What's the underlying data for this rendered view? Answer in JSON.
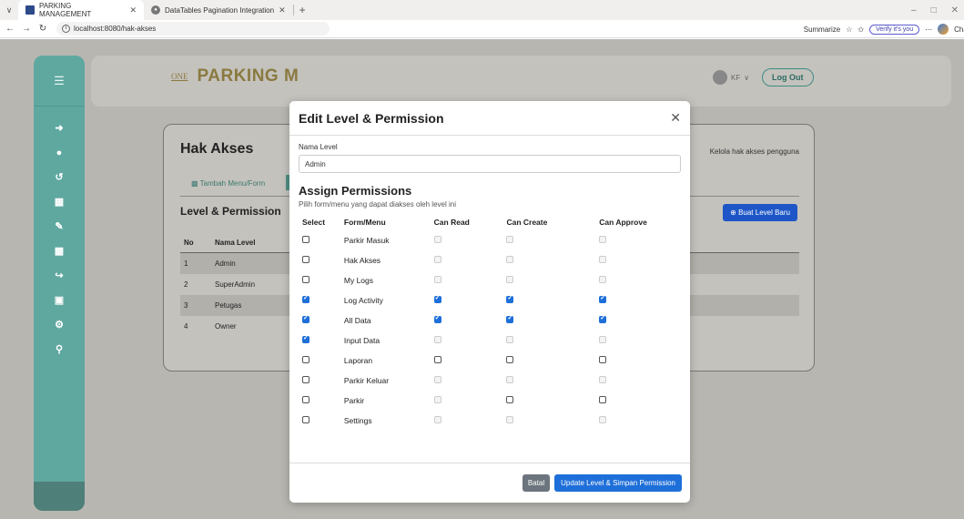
{
  "browser": {
    "tabs": [
      {
        "title": "PARKING MANAGEMENT",
        "active": true
      },
      {
        "title": "DataTables Pagination Integration",
        "active": false
      }
    ],
    "url": "localhost:8080/hak-akses",
    "right": {
      "summarize": "Summarize",
      "verify": "Verify it's you",
      "chat": "Chat"
    }
  },
  "app": {
    "brand_logo": "ONE",
    "brand_name": "PARKING M",
    "user_initials": "KF",
    "logout_label": "Log Out",
    "sidebar_icons": [
      "menu-icon",
      "login-icon",
      "users-icon",
      "history-icon",
      "table-icon",
      "pen-icon",
      "report-icon",
      "logout-arrow-icon",
      "card-icon",
      "gear-icon",
      "key-icon"
    ]
  },
  "card": {
    "title": "Hak Akses",
    "subtitle": "Kelola hak akses pengguna",
    "tab_label": "Tambah Menu/Form",
    "section_title": "Level & Permission",
    "new_button": "Buat Level Baru",
    "table": {
      "headers": [
        "No",
        "Nama Level"
      ],
      "rows": [
        {
          "no": "1",
          "name": "Admin"
        },
        {
          "no": "2",
          "name": "SuperAdmin"
        },
        {
          "no": "3",
          "name": "Petugas"
        },
        {
          "no": "4",
          "name": "Owner"
        }
      ]
    }
  },
  "modal": {
    "title": "Edit Level & Permission",
    "level_label": "Nama Level",
    "level_value": "Admin",
    "assign_title": "Assign Permissions",
    "assign_desc": "Pilih form/menu yang dapat diakses oleh level ini",
    "headers": [
      "Select",
      "Form/Menu",
      "Can Read",
      "Can Create",
      "Can Approve"
    ],
    "rows": [
      {
        "form": "Parkir Masuk",
        "select": false,
        "read": "dis",
        "create": "dis",
        "approve": "dis"
      },
      {
        "form": "Hak Akses",
        "select": false,
        "read": "dis",
        "create": "dis",
        "approve": "dis"
      },
      {
        "form": "My Logs",
        "select": false,
        "read": "dis",
        "create": "dis",
        "approve": "dis"
      },
      {
        "form": "Log Activity",
        "select": true,
        "read": "on",
        "create": "on",
        "approve": "on"
      },
      {
        "form": "All Data",
        "select": true,
        "read": "on",
        "create": "on",
        "approve": "on"
      },
      {
        "form": "Input Data",
        "select": true,
        "read": "dis",
        "create": "dis",
        "approve": "dis"
      },
      {
        "form": "Laporan",
        "select": false,
        "read": "off",
        "create": "off",
        "approve": "off"
      },
      {
        "form": "Parkir Keluar",
        "select": false,
        "read": "dis",
        "create": "dis",
        "approve": "dis"
      },
      {
        "form": "Parkir",
        "select": false,
        "read": "dis",
        "create": "off",
        "approve": "off"
      },
      {
        "form": "Settings",
        "select": false,
        "read": "dis",
        "create": "dis",
        "approve": "dis"
      }
    ],
    "cancel_label": "Batal",
    "submit_label": "Update Level & Simpan Permission"
  }
}
